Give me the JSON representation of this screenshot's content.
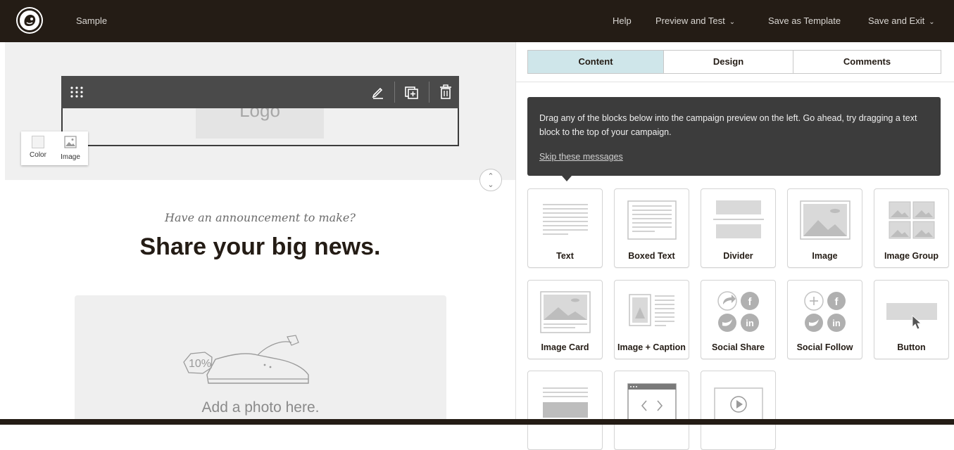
{
  "topbar": {
    "campaign_name": "Sample",
    "help": "Help",
    "preview_and_test": "Preview and Test",
    "save_as_template": "Save as Template",
    "save_and_exit": "Save and Exit"
  },
  "canvas": {
    "logo_placeholder": "Logo",
    "bg_options": {
      "color": "Color",
      "image": "Image"
    },
    "tagline": "Have an announcement to make?",
    "headline": "Share your big news.",
    "photo_caption": "Add a photo here.",
    "photo_badge": "10%"
  },
  "panel": {
    "tabs": [
      "Content",
      "Design",
      "Comments"
    ],
    "active_tab": "Content",
    "tip_text": "Drag any of the blocks below into the campaign preview on the left. Go ahead, try dragging a text block to the top of your campaign.",
    "tip_skip": "Skip these messages",
    "blocks": [
      {
        "label": "Text",
        "icon": "text-block-icon"
      },
      {
        "label": "Boxed Text",
        "icon": "boxed-text-block-icon"
      },
      {
        "label": "Divider",
        "icon": "divider-block-icon"
      },
      {
        "label": "Image",
        "icon": "image-block-icon"
      },
      {
        "label": "Image Group",
        "icon": "image-group-block-icon"
      },
      {
        "label": "Image Card",
        "icon": "image-card-block-icon"
      },
      {
        "label": "Image + Caption",
        "icon": "image-caption-block-icon"
      },
      {
        "label": "Social Share",
        "icon": "social-share-block-icon"
      },
      {
        "label": "Social Follow",
        "icon": "social-follow-block-icon"
      },
      {
        "label": "Button",
        "icon": "button-block-icon"
      },
      {
        "label": "",
        "icon": "footer-block-icon"
      },
      {
        "label": "",
        "icon": "code-block-icon"
      },
      {
        "label": "",
        "icon": "video-block-icon"
      }
    ]
  },
  "colors": {
    "topbar_bg": "#241c15",
    "active_tab_bg": "#cfe6ea",
    "tip_bg": "#3c3c3c",
    "icon_gray": "#c8c8c8"
  }
}
